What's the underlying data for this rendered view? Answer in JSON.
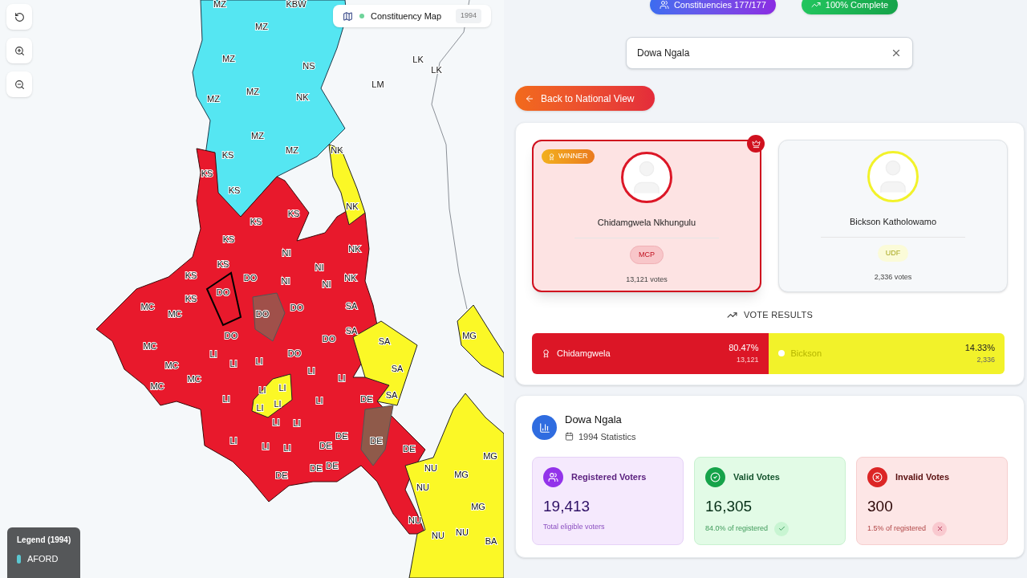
{
  "map": {
    "controls": [
      {
        "kind": "reset"
      },
      {
        "kind": "zoom_in"
      },
      {
        "kind": "zoom_out"
      }
    ],
    "header": {
      "title": "Constituency Map",
      "year": "1994"
    },
    "labels": [
      "MZ",
      "KBW",
      "MZ",
      "MZ",
      "NS",
      "MZ",
      "NK",
      "MZ",
      "MZ",
      "MZ",
      "KS",
      "KS",
      "LK",
      "LK",
      "LM",
      "KS",
      "KS",
      "KS",
      "KS",
      "NI",
      "NK",
      "KS",
      "NI",
      "DO",
      "NI",
      "KS",
      "NI",
      "NK",
      "DO",
      "MC",
      "MC",
      "KS",
      "DO",
      "DO",
      "SA",
      "DO",
      "DO",
      "SA",
      "MC",
      "LI",
      "DO",
      "LI",
      "MC",
      "LI",
      "LI",
      "LI",
      "MC",
      "MC",
      "LI",
      "LI",
      "LI",
      "DE",
      "LI",
      "LI",
      "DE",
      "LI",
      "LI",
      "LI",
      "DE",
      "DE",
      "DE",
      "DE",
      "DE",
      "NU",
      "NK",
      "NK",
      "SA",
      "SA",
      "SA",
      "LI",
      "LI",
      "LI",
      "DE",
      "MG",
      "MG",
      "MG",
      "MG",
      "NU",
      "NU",
      "NU",
      "NU",
      "BA"
    ],
    "legend": {
      "title": "Legend (1994)",
      "items": [
        {
          "label": "AFORD",
          "color": "#5bc8d2"
        }
      ]
    }
  },
  "summary": {
    "badges": [
      {
        "label": "Constituencies 177/177",
        "kind": "constituencies"
      },
      {
        "label": "100% Complete",
        "kind": "complete"
      }
    ]
  },
  "search": {
    "value": "Dowa Ngala"
  },
  "back_button": "Back to National View",
  "candidates": [
    {
      "name": "Chidamgwela Nkhungulu",
      "party": "MCP",
      "votes": "13,121 votes",
      "winner": true,
      "color": "#dc1626"
    },
    {
      "name": "Bickson Katholowamo",
      "party": "UDF",
      "votes": "2,336 votes",
      "winner": false,
      "color": "#f2f22a"
    }
  ],
  "winner_badge": "WINNER",
  "vote_results": {
    "title": "VOTE RESULTS",
    "segments": [
      {
        "name": "Chidamgwela",
        "percent": "80.47%",
        "votes": "13,121",
        "winner": true,
        "color": "#dc1626",
        "level": 0.5
      },
      {
        "name": "Bickson",
        "percent": "14.33%",
        "votes": "2,336",
        "winner": false,
        "color": "#f2f22a"
      }
    ]
  },
  "statistics": {
    "title": "Dowa Ngala",
    "subtitle": "1994 Statistics",
    "cards": [
      {
        "kind": "registered",
        "label": "Registered Voters",
        "value": "19,413",
        "note": "Total eligible voters"
      },
      {
        "kind": "valid",
        "label": "Valid Votes",
        "value": "16,305",
        "note": "84.0% of registered"
      },
      {
        "kind": "invalid",
        "label": "Invalid Votes",
        "value": "300",
        "note": "1.5% of registered"
      }
    ]
  }
}
